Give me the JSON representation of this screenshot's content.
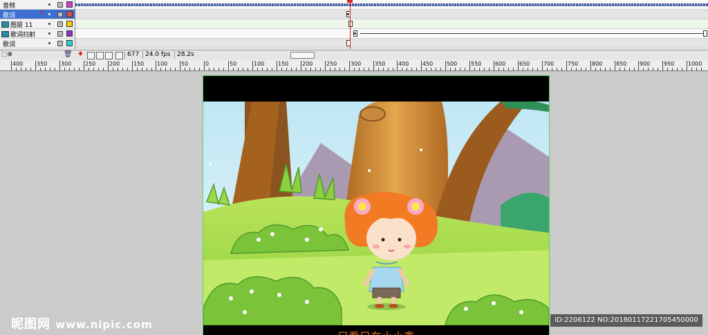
{
  "layers": [
    {
      "name": "音频",
      "color": "#d23cd2",
      "selected": false,
      "type": "audio"
    },
    {
      "name": "歌词",
      "color": "#e84a4a",
      "selected": true,
      "type": "normal"
    },
    {
      "name": "图层 11",
      "color": "#f0d000",
      "selected": false,
      "type": "mask"
    },
    {
      "name": "歌词扫射",
      "color": "#8a2ec4",
      "selected": false,
      "type": "mask"
    },
    {
      "name": "歌词",
      "color": "#2ed0d0",
      "selected": false,
      "type": "normal"
    }
  ],
  "timeline_status": {
    "frame": "677",
    "fps": "24.0 fps",
    "time": "28.2s"
  },
  "ruler_labels": [
    "400",
    "350",
    "300",
    "250",
    "200",
    "150",
    "100",
    "50",
    "0",
    "50",
    "100",
    "150",
    "200",
    "250",
    "300",
    "350",
    "400",
    "450",
    "500",
    "550",
    "600",
    "650",
    "700",
    "750",
    "800",
    "850",
    "900",
    "950",
    "1000"
  ],
  "lyric": "只看只在小小鑫",
  "watermark": {
    "site": "昵图网",
    "url": "www.nipic.com",
    "id_text": "ID:2206122 NO:20180117221705450000"
  },
  "colors": {
    "stage_border": "#5fd15f",
    "playhead": "#d22222",
    "selected_layer": "#3c6fd1",
    "lyric": "#e36d2b"
  }
}
